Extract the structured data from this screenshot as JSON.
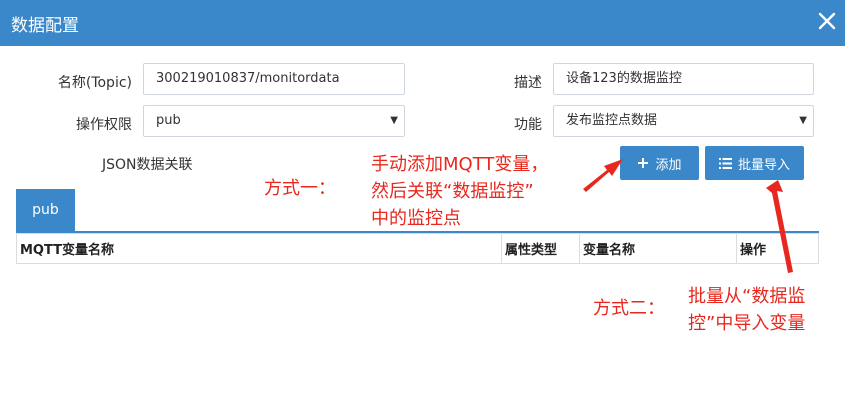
{
  "dialog": {
    "title": "数据配置"
  },
  "form": {
    "name_label": "名称(Topic)",
    "name_value": "300219010837/monitordata",
    "desc_label": "描述",
    "desc_value": "设备123的数据监控",
    "perm_label": "操作权限",
    "perm_value": "pub",
    "func_label": "功能",
    "func_value": "发布监控点数据",
    "json_label": "JSON数据关联"
  },
  "buttons": {
    "add": "添加",
    "batch_import": "批量导入"
  },
  "tab": {
    "label": "pub"
  },
  "table": {
    "columns": [
      "MQTT变量名称",
      "属性类型",
      "变量名称",
      "操作"
    ]
  },
  "annotations": {
    "method1_label": "方式一：",
    "method1_text_1": "手动添加MQTT变量，",
    "method1_text_2": "然后关联“数据监控”",
    "method1_text_3": "中的监控点",
    "method2_label": "方式二：",
    "method2_text_1": "批量从“数据监",
    "method2_text_2": "控”中导入变量"
  },
  "colors": {
    "primary": "#3a87c9",
    "annotation": "#e8281e"
  }
}
